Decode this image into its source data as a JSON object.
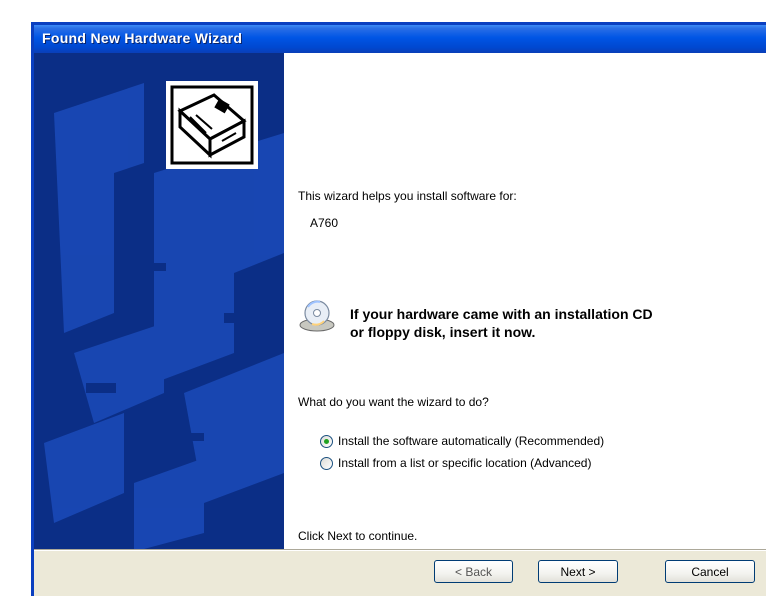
{
  "window": {
    "title": "Found New Hardware Wizard"
  },
  "colors": {
    "titlebar": "#0055e5",
    "side_panel": "#0b2e86",
    "dialog_face": "#ece9d8",
    "radio_selected": "#21a121"
  },
  "icons": {
    "header": "hardware-wizard-icon",
    "media": "cd-disk-icon"
  },
  "content": {
    "intro": "This wizard helps you install software for:",
    "device_name": "A760",
    "cd_prompt_line1": "If your hardware came with an installation CD",
    "cd_prompt_line2": "or floppy disk, insert it now.",
    "question": "What do you want the wizard to do?",
    "options": [
      {
        "label": "Install the software automatically (Recommended)",
        "selected": true
      },
      {
        "label": "Install from a list or specific location (Advanced)",
        "selected": false
      }
    ],
    "continue_text": "Click Next to continue."
  },
  "buttons": {
    "back": "< Back",
    "next": "Next >",
    "cancel": "Cancel"
  }
}
